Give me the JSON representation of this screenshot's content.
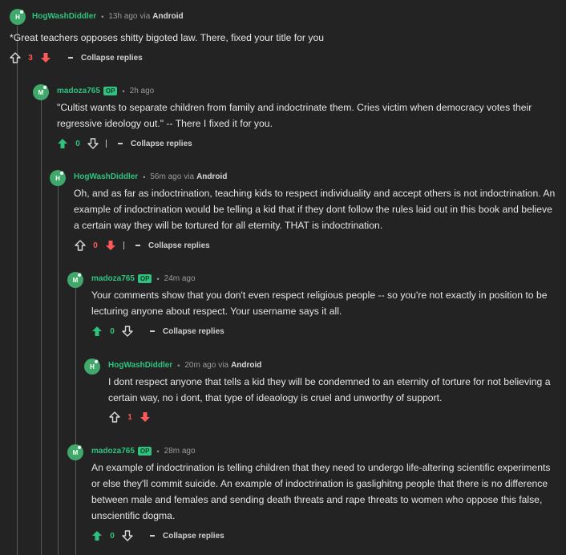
{
  "colors": {
    "background": "#232323",
    "accent": "#2ec27e",
    "downvote": "#ff5a5a",
    "avatar": "#3fa86a"
  },
  "comments": [
    {
      "avatar_letter": "H",
      "author": "HogWashDiddler",
      "op": false,
      "time": "13h ago",
      "via": "via",
      "platform": "Android",
      "body": "*Great teachers opposes shitty bigoted law. There, fixed your title for you",
      "score": "3",
      "vote_state": "down",
      "collapse": "Collapse replies"
    },
    {
      "avatar_letter": "M",
      "author": "madoza765",
      "op": true,
      "op_label": "OP",
      "time": "2h ago",
      "body": "\"Cultist wants to separate children from family and indoctrinate them. Cries victim when democracy votes their regressive ideology out.\" -- There I fixed it for you.",
      "score": "0",
      "vote_state": "up",
      "collapse": "Collapse replies"
    },
    {
      "avatar_letter": "H",
      "author": "HogWashDiddler",
      "op": false,
      "time": "56m ago",
      "via": "via",
      "platform": "Android",
      "body": "Oh, and as far as indoctrination, teaching kids to respect individuality and accept others is not indoctrination. An example of indoctrination would be telling a kid that if they dont follow the rules laid out in this book and believe a certain way they will be tortured for all eternity. THAT is indoctrination.",
      "score": "0",
      "vote_state": "down",
      "collapse": "Collapse replies"
    },
    {
      "avatar_letter": "M",
      "author": "madoza765",
      "op": true,
      "op_label": "OP",
      "time": "24m ago",
      "body": "Your comments show that you don't even respect religious people -- so you're not exactly in position to be lecturing anyone about respect. Your username says it all.",
      "score": "0",
      "vote_state": "up",
      "collapse": "Collapse replies"
    },
    {
      "avatar_letter": "H",
      "author": "HogWashDiddler",
      "op": false,
      "time": "20m ago",
      "via": "via",
      "platform": "Android",
      "body": "I dont respect anyone that tells a kid they will be condemned to an eternity of torture for not believing a certain way, no i dont, that type of ideaology is cruel and unworthy of support.",
      "score": "1",
      "vote_state": "down"
    },
    {
      "avatar_letter": "M",
      "author": "madoza765",
      "op": true,
      "op_label": "OP",
      "time": "28m ago",
      "body": "An example of indoctrination is telling children that they need to undergo life-altering scientific experiments or else they'll commit suicide. An example of indoctrination is gaslighitng people that there is no difference between male and females and sending death threats and rape threats to women who oppose this false, unscientific dogma.",
      "score": "0",
      "vote_state": "up",
      "collapse": "Collapse replies"
    }
  ]
}
